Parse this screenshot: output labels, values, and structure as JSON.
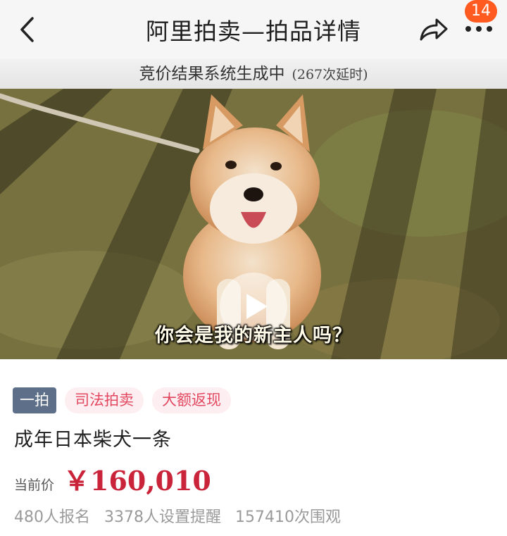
{
  "header": {
    "title": "阿里拍卖—拍品详情",
    "notification_count": "14",
    "icons": [
      "back-arrow-icon",
      "share-icon",
      "more-dots-icon"
    ]
  },
  "status_banner": {
    "text": "竞价结果系统生成中",
    "delay_text": "(267次延时)"
  },
  "media": {
    "caption": "你会是我的新主人吗？",
    "type": "video"
  },
  "tags": [
    "一拍",
    "司法拍卖",
    "大额返现"
  ],
  "item": {
    "title": "成年日本柴犬一条",
    "price_label": "当前价",
    "price": "￥160,010"
  },
  "stats": {
    "signups": "480人报名",
    "reminders": "3378人设置提醒",
    "views": "157410次围观"
  },
  "colors": {
    "accent_red": "#c9243a",
    "badge_orange": "#ff5a1f",
    "tag_primary": "#5e6f8a",
    "tag_pink_text": "#e3475f"
  }
}
